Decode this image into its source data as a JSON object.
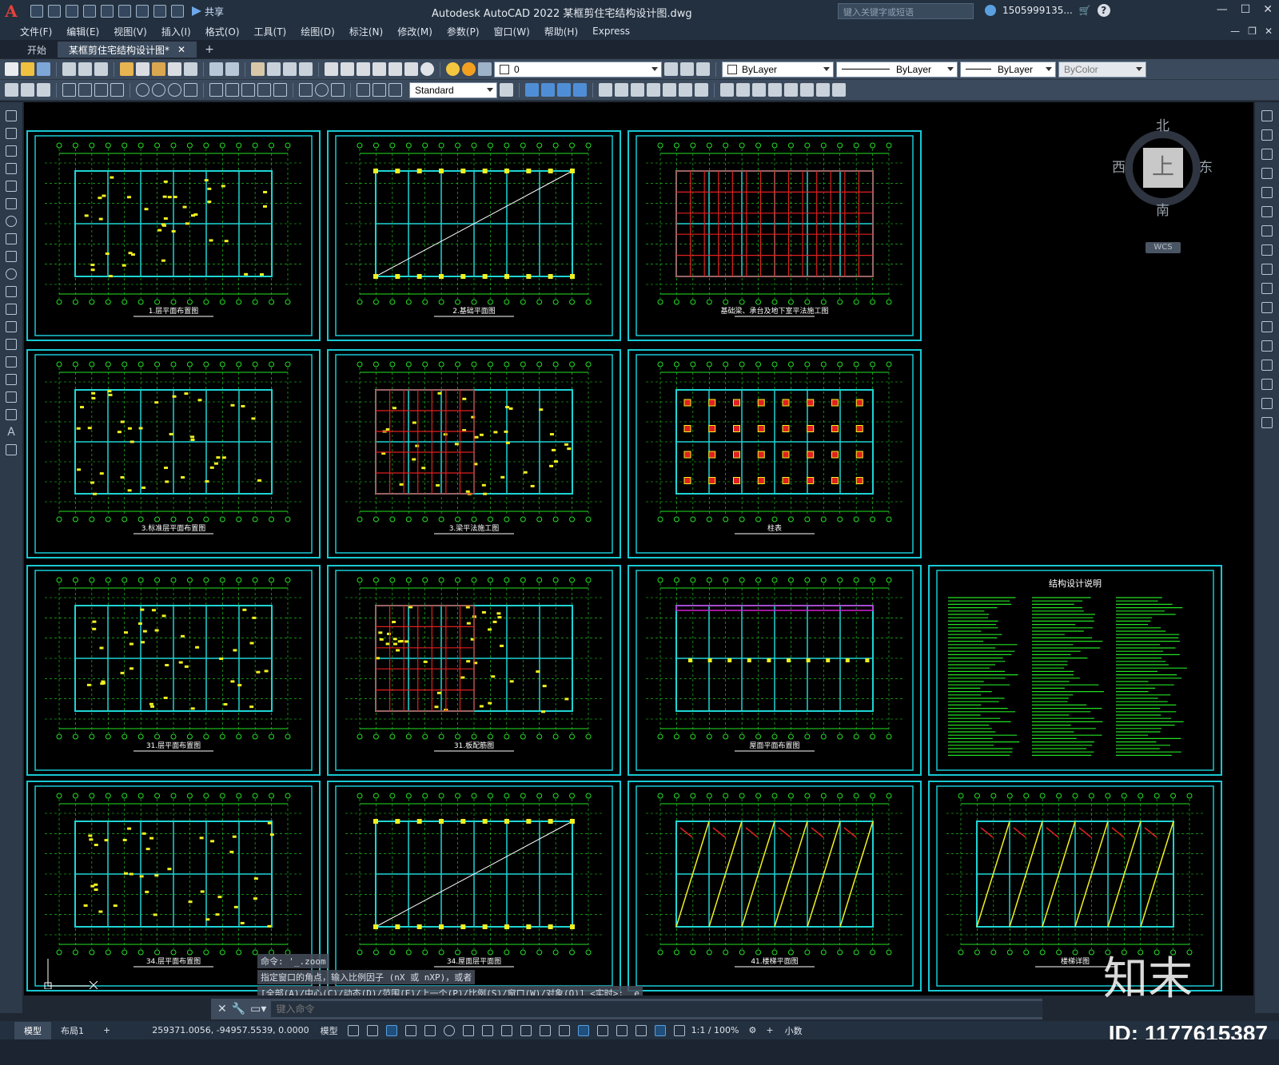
{
  "app": {
    "title": "Autodesk AutoCAD 2022    某框剪住宅结构设计图.dwg",
    "share_label": "共享",
    "search_placeholder": "键入关键字或短语",
    "account": "1505999135...",
    "window_controls": [
      "—",
      "☐",
      "✕"
    ]
  },
  "menu": [
    "文件(F)",
    "编辑(E)",
    "视图(V)",
    "插入(I)",
    "格式(O)",
    "工具(T)",
    "绘图(D)",
    "标注(N)",
    "修改(M)",
    "参数(P)",
    "窗口(W)",
    "帮助(H)",
    "Express"
  ],
  "tabs": {
    "start": "开始",
    "doc": "某框剪住宅结构设计图*",
    "close": "✕",
    "add": "+"
  },
  "toolbar": {
    "layer_value": "0",
    "color_value": "ByLayer",
    "linetype_value": "ByLayer",
    "lineweight_value": "ByLayer",
    "plotstyle_value": "ByColor",
    "textstyle_value": "Standard"
  },
  "viewcube": {
    "north": "北",
    "south": "南",
    "east": "东",
    "west": "西",
    "face": "上",
    "wcs": "WCS"
  },
  "command_history": [
    "命令: '_.zoom",
    "指定窗口的角点，输入比例因子 (nX 或 nXP)，或者",
    "[全部(A)/中心(C)/动态(D)/范围(E)/上一个(P)/比例(S)/窗口(W)/对象(O)] <实时>: _e"
  ],
  "command_placeholder": "键入命令",
  "status": {
    "model_tab": "模型",
    "layout_tab": "布局1",
    "add_tab": "+",
    "coords": "259371.0056, -94957.5539, 0.0000",
    "space": "模型",
    "scale": "1:1 / 100%",
    "units": "小数"
  },
  "drawing_sheets": {
    "sheet_titles": [
      "1.层平面布置图",
      "2.基础平面图",
      "基础梁、承台及地下室平法施工图",
      "3.标准层平面布置图",
      "3.梁平法施工图",
      "柱表",
      "31.层平面布置图",
      "31.板配筋图",
      "屋面平面布置图",
      "结构设计说明",
      "34.层平面布置图",
      "34.屋面层平面图",
      "41.楼梯平面图",
      "楼梯详图"
    ],
    "note_title": "结构设计说明"
  },
  "watermark": {
    "logo": "知末",
    "id": "ID: 1177615387"
  },
  "colors": {
    "canvas": "#000000",
    "sheet_frame": "#19c8d4",
    "grid_green": "#23e023",
    "walls_cyan": "#1fd4d4",
    "rebar_red": "#e02020",
    "anno_yellow": "#f0f020",
    "ui_dark": "#23303f",
    "ui_mid": "#3b4a5c"
  }
}
